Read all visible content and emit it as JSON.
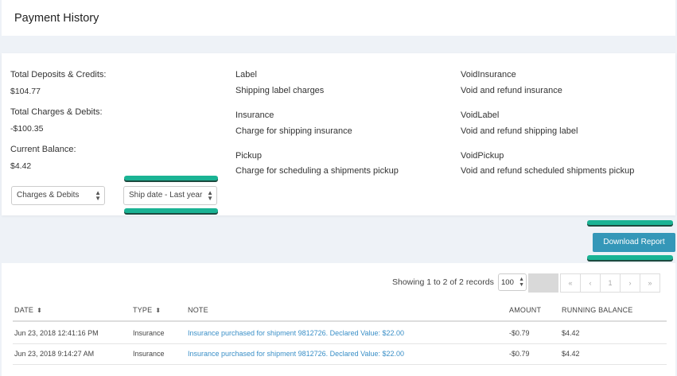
{
  "header": {
    "title": "Payment History"
  },
  "summary": {
    "deposits_label": "Total Deposits & Credits:",
    "deposits_value": "$104.77",
    "charges_label": "Total Charges & Debits:",
    "charges_value": "-$100.35",
    "balance_label": "Current Balance:",
    "balance_value": "$4.42"
  },
  "filters": {
    "type_select": "Charges & Debits",
    "date_select": "Ship date - Last year"
  },
  "legend": [
    {
      "name": "Label",
      "desc": "Shipping label charges"
    },
    {
      "name": "Insurance",
      "desc": "Charge for shipping insurance"
    },
    {
      "name": "Pickup",
      "desc": "Charge for scheduling a shipments pickup"
    },
    {
      "name": "VoidInsurance",
      "desc": "Void and refund insurance"
    },
    {
      "name": "VoidLabel",
      "desc": "Void and refund shipping label"
    },
    {
      "name": "VoidPickup",
      "desc": "Void and refund scheduled shipments pickup"
    }
  ],
  "actions": {
    "download_label": "Download Report"
  },
  "table": {
    "showing": "Showing 1 to 2 of 2 records",
    "page_size": "100",
    "pager": [
      "«",
      "‹",
      "1",
      "›",
      "»"
    ],
    "columns": [
      "DATE",
      "TYPE",
      "NOTE",
      "AMOUNT",
      "RUNNING BALANCE"
    ],
    "rows": [
      {
        "date": "Jun 23, 2018 12:41:16 PM",
        "type": "Insurance",
        "note": "Insurance purchased for shipment 9812726. Declared Value: $22.00",
        "amount": "-$0.79",
        "balance": "$4.42"
      },
      {
        "date": "Jun 23, 2018 9:14:27 AM",
        "type": "Insurance",
        "note": "Insurance purchased for shipment 9812726. Declared Value: $22.00",
        "amount": "-$0.79",
        "balance": "$4.42"
      }
    ]
  },
  "colors": {
    "accent": "#3497b8",
    "highlight": "#1ab394",
    "link": "#3a8fc7"
  },
  "icons": {
    "sort": "sort-arrows-icon",
    "select_caret": "updown-caret-icon"
  }
}
